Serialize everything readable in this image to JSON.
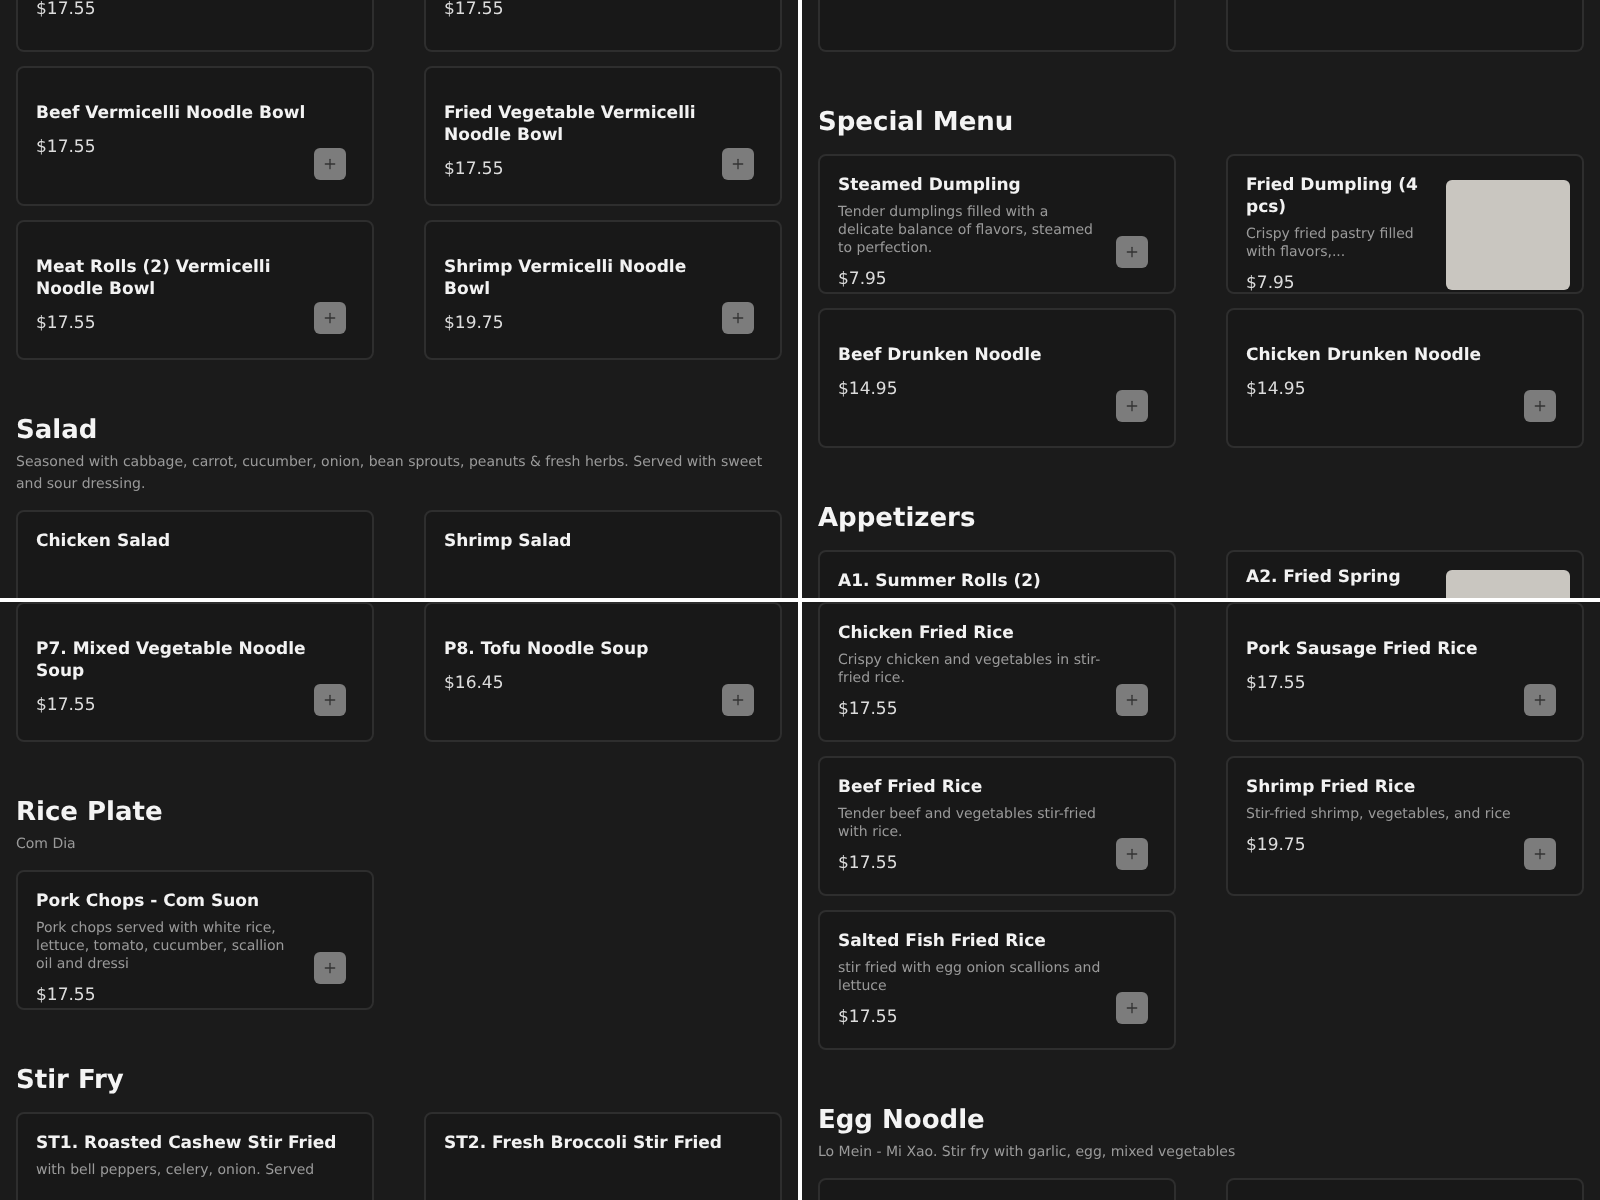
{
  "panels": [
    {
      "sections": [
        {
          "items": [
            {
              "kind": "tail",
              "price": "$17.55"
            },
            {
              "kind": "tail",
              "price": "$17.55"
            },
            {
              "kind": "full",
              "title": "Beef Vermicelli Noodle Bowl",
              "price": "$17.55"
            },
            {
              "kind": "full",
              "title": "Fried Vegetable Vermicelli Noodle Bowl",
              "price": "$17.55"
            },
            {
              "kind": "full",
              "title": "Meat Rolls (2) Vermicelli Noodle Bowl",
              "price": "$17.55"
            },
            {
              "kind": "full",
              "title": "Shrimp Vermicelli Noodle Bowl",
              "price": "$19.75"
            }
          ]
        },
        {
          "heading": "Salad",
          "description": "Seasoned with cabbage, carrot, cucumber, onion, bean sprouts, peanuts & fresh herbs. Served with sweet and sour dressing.",
          "items": [
            {
              "kind": "cut",
              "title": "Chicken Salad"
            },
            {
              "kind": "cut",
              "title": "Shrimp Salad"
            }
          ]
        }
      ]
    },
    {
      "sections": [
        {
          "items": [
            {
              "kind": "tail"
            },
            {
              "kind": "tail"
            }
          ]
        },
        {
          "heading": "Special Menu",
          "items": [
            {
              "kind": "full",
              "title": "Steamed Dumpling",
              "description": "Tender dumplings filled with a delicate balance of flavors, steamed to perfection.",
              "price": "$7.95"
            },
            {
              "kind": "photo",
              "title": "Fried Dumpling (4 pcs)",
              "description": "Crispy fried pastry filled with flavors,...",
              "price": "$7.95"
            },
            {
              "kind": "full",
              "title": "Beef Drunken Noodle",
              "price": "$14.95"
            },
            {
              "kind": "full",
              "title": "Chicken Drunken Noodle",
              "price": "$14.95"
            }
          ]
        },
        {
          "heading": "Appetizers",
          "items": [
            {
              "kind": "cut",
              "title": "A1. Summer Rolls (2)"
            },
            {
              "kind": "cutphoto",
              "title": "A2. Fried Spring"
            }
          ]
        }
      ]
    },
    {
      "sections": [
        {
          "items": [
            {
              "kind": "full",
              "title": "P7. Mixed Vegetable Noodle Soup",
              "price": "$17.55"
            },
            {
              "kind": "full",
              "title": "P8. Tofu Noodle Soup",
              "price": "$16.45"
            }
          ]
        },
        {
          "heading": "Rice Plate",
          "description": "Com Dia",
          "items": [
            {
              "kind": "full",
              "title": "Pork Chops - Com Suon",
              "description": "Pork chops served with white rice, lettuce, tomato, cucumber, scallion oil and dressi",
              "price": "$17.55"
            }
          ]
        },
        {
          "heading": "Stir Fry",
          "items": [
            {
              "kind": "cut",
              "title": "ST1. Roasted Cashew Stir Fried",
              "description": "with bell peppers, celery, onion. Served"
            },
            {
              "kind": "cut",
              "title": "ST2. Fresh Broccoli Stir Fried"
            }
          ]
        }
      ]
    },
    {
      "sections": [
        {
          "items": [
            {
              "kind": "full",
              "title": "Chicken Fried Rice",
              "description": "Crispy chicken and vegetables in stir-fried rice.",
              "price": "$17.55"
            },
            {
              "kind": "full",
              "title": "Pork Sausage Fried Rice",
              "price": "$17.55"
            },
            {
              "kind": "full",
              "title": "Beef Fried Rice",
              "description": "Tender beef and vegetables stir-fried with rice.",
              "price": "$17.55"
            },
            {
              "kind": "full",
              "title": "Shrimp Fried Rice",
              "description": "Stir-fried shrimp, vegetables, and rice",
              "price": "$19.75"
            },
            {
              "kind": "full",
              "title": "Salted Fish Fried Rice",
              "description": "stir fried with egg onion scallions and lettuce",
              "price": "$17.55"
            }
          ]
        },
        {
          "heading": "Egg Noodle",
          "description": "Lo Mein - Mi Xao. Stir fry with garlic, egg, mixed vegetables",
          "items": [
            {
              "kind": "cut"
            },
            {
              "kind": "cut"
            }
          ]
        }
      ]
    }
  ]
}
